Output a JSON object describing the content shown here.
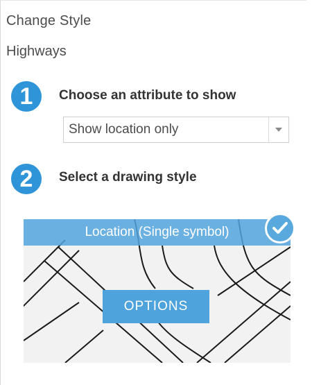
{
  "panel": {
    "title": "Change Style",
    "layer_name": "Highways"
  },
  "steps": [
    {
      "number": "1",
      "label": "Choose an attribute to show"
    },
    {
      "number": "2",
      "label": "Select a drawing style"
    }
  ],
  "attribute_select": {
    "value": "Show location only",
    "icon": "caret-down-icon"
  },
  "style_card": {
    "label": "Location (Single symbol)",
    "selected": true,
    "selected_icon": "checkmark-icon",
    "options_label": "OPTIONS"
  },
  "colors": {
    "accent": "#2f95d8",
    "banner": "#52a5de",
    "button": "#4fa3dc"
  }
}
